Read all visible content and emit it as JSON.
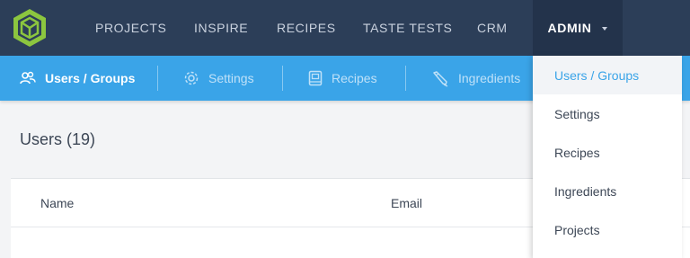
{
  "top_nav": {
    "items": [
      {
        "label": "PROJECTS"
      },
      {
        "label": "INSPIRE"
      },
      {
        "label": "RECIPES"
      },
      {
        "label": "TASTE TESTS"
      },
      {
        "label": "CRM"
      },
      {
        "label": "ADMIN",
        "active": true
      }
    ],
    "logo_icon": "hexagon-cube-logo",
    "colors": {
      "bar": "#2c3e58",
      "active": "#23334b",
      "logo_green": "#8cc63f"
    }
  },
  "sub_nav": {
    "items": [
      {
        "label": "Users / Groups",
        "icon": "users-icon",
        "active": true
      },
      {
        "label": "Settings",
        "icon": "gear-icon"
      },
      {
        "label": "Recipes",
        "icon": "book-icon"
      },
      {
        "label": "Ingredients",
        "icon": "pencil-icon"
      }
    ],
    "color": "#3aa4e8"
  },
  "main": {
    "heading": "Users (19)",
    "table": {
      "columns": [
        "Name",
        "Email"
      ]
    }
  },
  "admin_dropdown": {
    "items": [
      {
        "label": "Users / Groups",
        "active": true
      },
      {
        "label": "Settings"
      },
      {
        "label": "Recipes"
      },
      {
        "label": "Ingredients"
      },
      {
        "label": "Projects"
      }
    ]
  }
}
